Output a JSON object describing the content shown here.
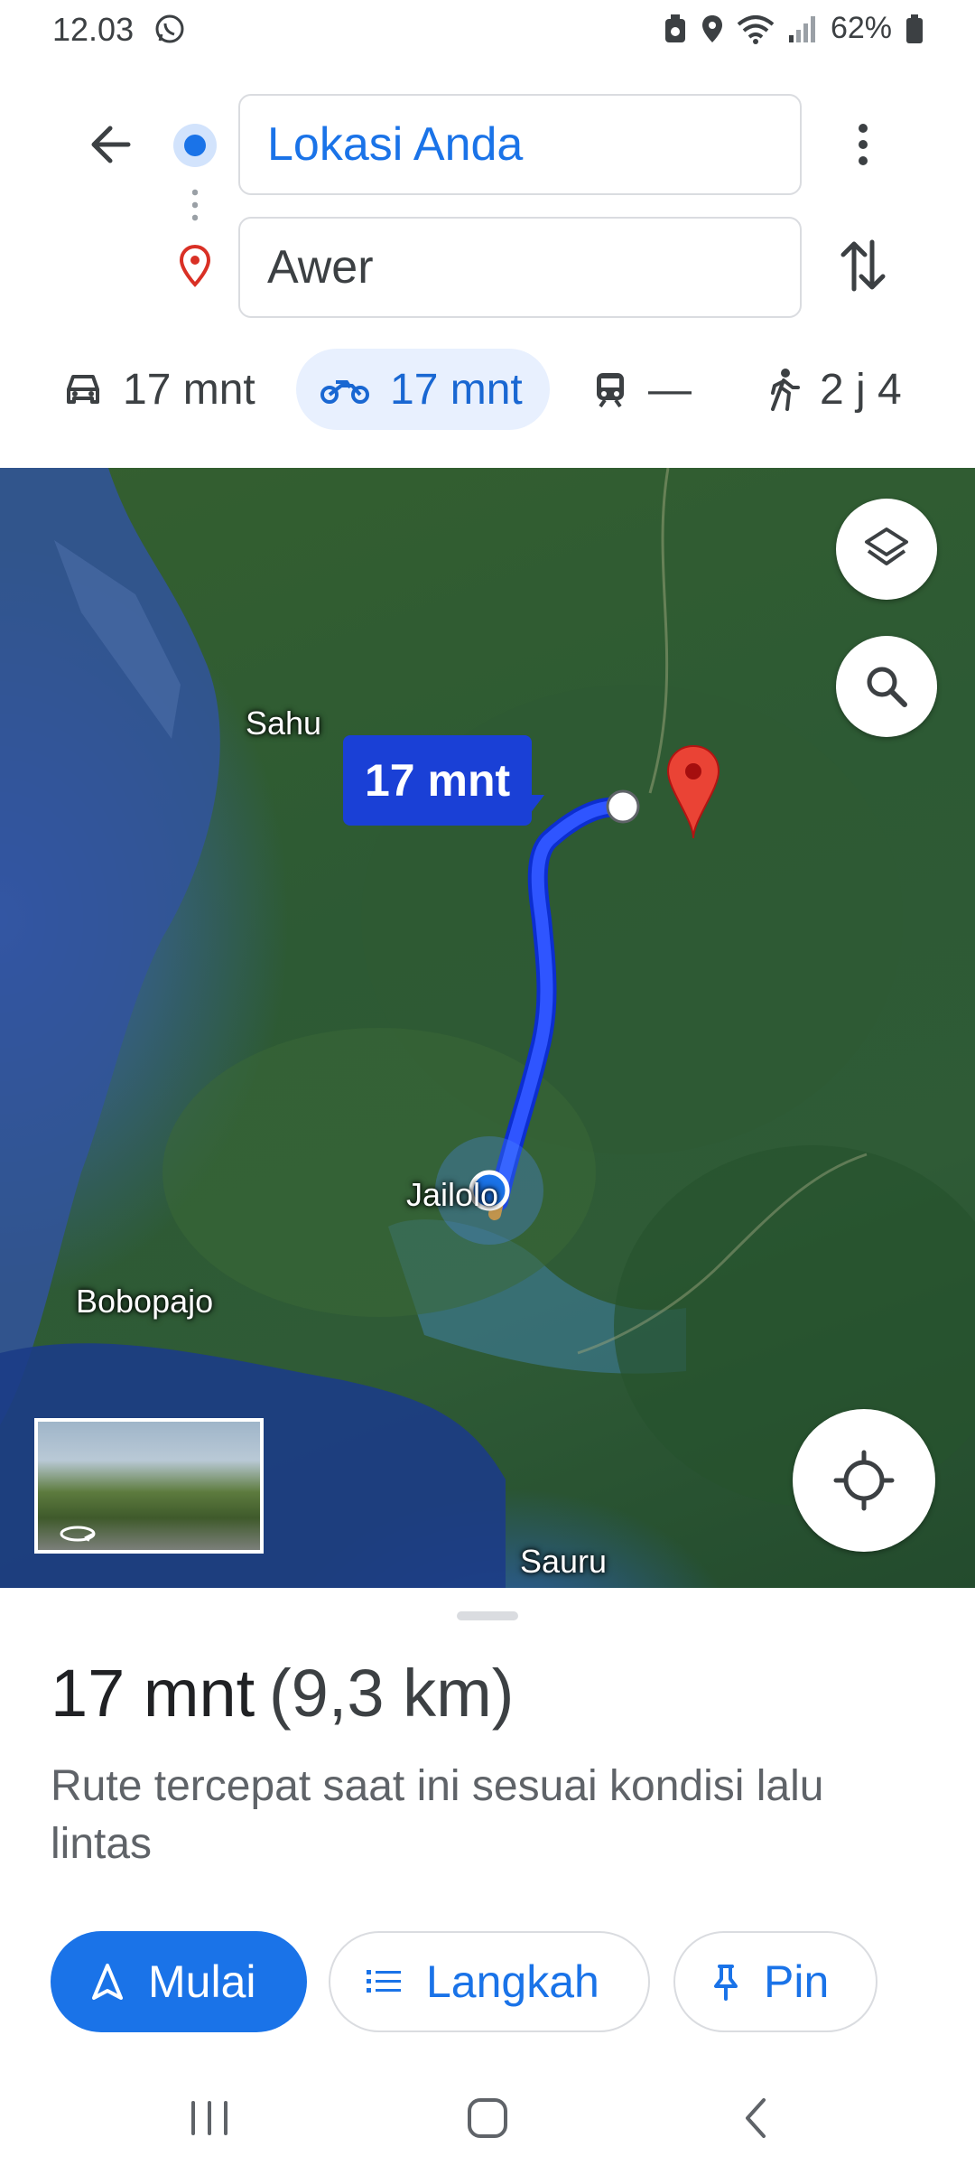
{
  "status_bar": {
    "time": "12.03",
    "battery": "62%"
  },
  "directions": {
    "origin": "Lokasi Anda",
    "destination": "Awer"
  },
  "modes": {
    "car": "17 mnt",
    "motorcycle": "17 mnt",
    "transit": "—",
    "walk": "2 j 4"
  },
  "map": {
    "labels": {
      "sahu": "Sahu",
      "jailolo": "Jailolo",
      "bobopajo": "Bobopajo",
      "sauru": "Sauru"
    },
    "route_badge": "17 mnt"
  },
  "sheet": {
    "duration": "17 mnt",
    "distance": "(9,3 km)",
    "description": "Rute tercepat saat ini sesuai kondisi lalu lintas",
    "buttons": {
      "start": "Mulai",
      "steps": "Langkah",
      "pin": "Pin"
    }
  },
  "colors": {
    "accent": "#1a73e8",
    "route": "#1a40d6",
    "pin": "#ea4335"
  }
}
